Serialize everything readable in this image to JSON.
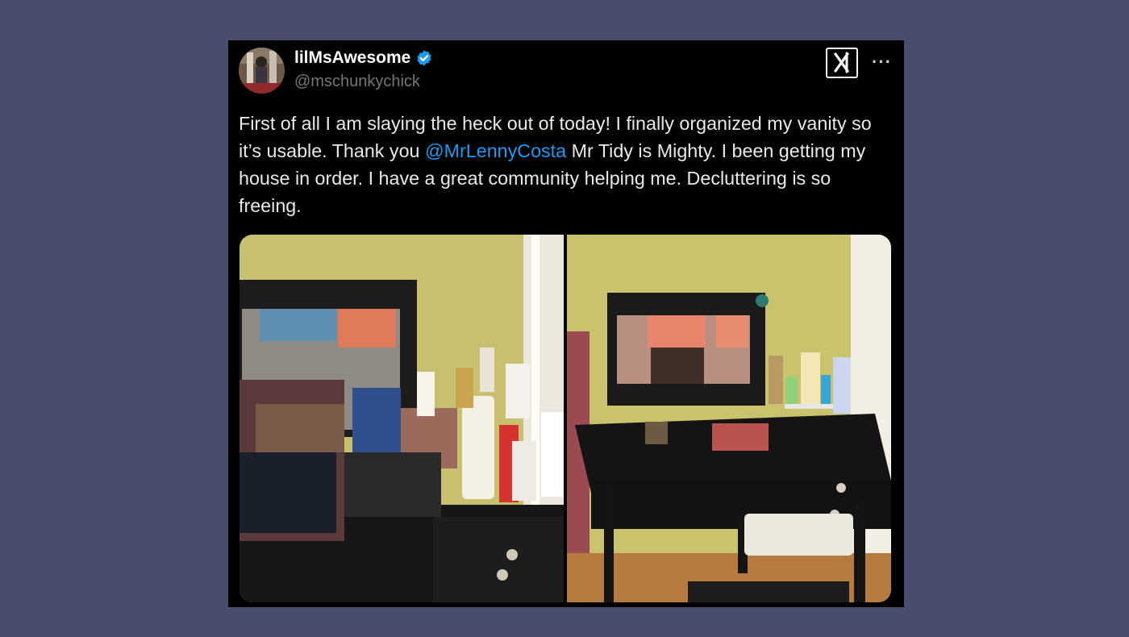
{
  "tweet": {
    "display_name": "lilMsAwesome",
    "verified": true,
    "handle": "@mschunkychick",
    "text_part1": "First of all I am slaying the heck out of today! I finally organized my vanity so it’s usable. Thank you ",
    "mention": "@MrLennyCosta",
    "text_part2": " Mr Tidy is Mighty. I been getting my house in order. I have a great community helping me. Decluttering is so freeing.",
    "media": [
      {
        "icon": "vanity-before-photo"
      },
      {
        "icon": "vanity-after-photo"
      }
    ]
  },
  "colors": {
    "background": "#4a4c6e",
    "card": "#000000",
    "text": "#e7e9ea",
    "muted": "#71767b",
    "link": "#1d9bf0",
    "verified": "#1d9bf0"
  }
}
